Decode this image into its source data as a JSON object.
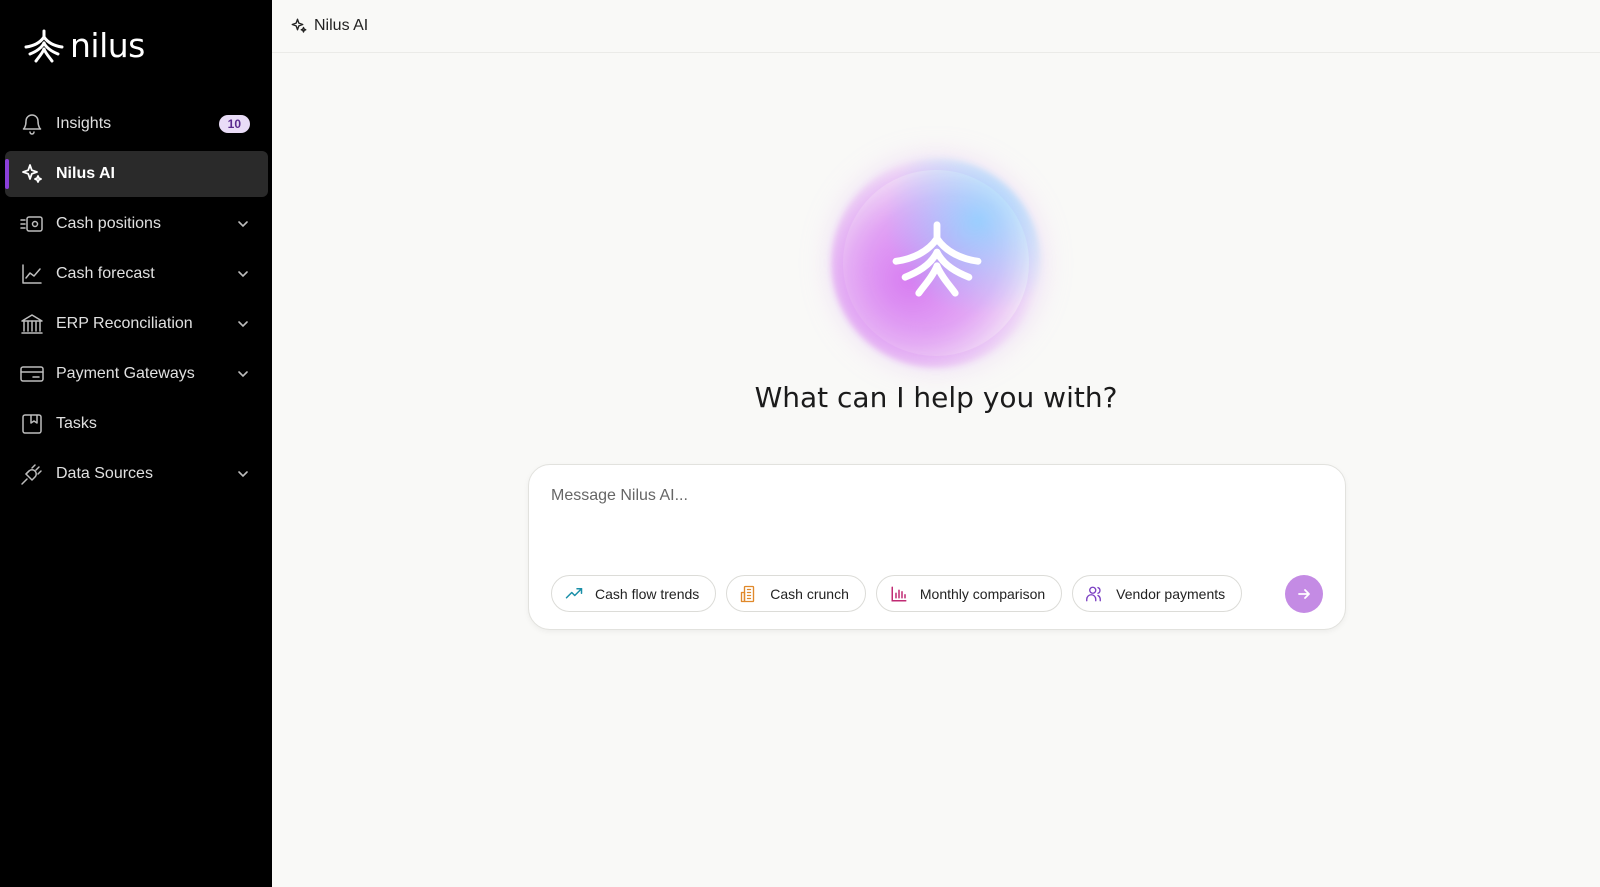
{
  "app": {
    "brand": "nilus"
  },
  "sidebar": {
    "items": [
      {
        "label": "Insights",
        "icon": "bell-icon",
        "badge": "10",
        "active": false,
        "expandable": false
      },
      {
        "label": "Nilus AI",
        "icon": "sparkles-icon",
        "active": true,
        "expandable": false
      },
      {
        "label": "Cash positions",
        "icon": "cash-positions-icon",
        "active": false,
        "expandable": true
      },
      {
        "label": "Cash forecast",
        "icon": "line-chart-icon",
        "active": false,
        "expandable": true
      },
      {
        "label": "ERP Reconciliation",
        "icon": "bank-icon",
        "active": false,
        "expandable": true
      },
      {
        "label": "Payment Gateways",
        "icon": "credit-card-icon",
        "active": false,
        "expandable": true
      },
      {
        "label": "Tasks",
        "icon": "book-icon",
        "active": false,
        "expandable": false
      },
      {
        "label": "Data Sources",
        "icon": "plug-icon",
        "active": false,
        "expandable": true
      }
    ],
    "active_color": "#8b3fd9"
  },
  "header": {
    "title": "Nilus AI",
    "icon": "sparkles-icon"
  },
  "main": {
    "headline": "What can I help you with?",
    "composer": {
      "placeholder": "Message Nilus AI...",
      "value": "",
      "send_icon": "arrow-right-icon",
      "send_color": "#c48be4"
    },
    "suggestions": [
      {
        "label": "Cash flow trends",
        "icon": "trending-up-icon",
        "color": "#1a8fa8"
      },
      {
        "label": "Cash crunch",
        "icon": "building-icon",
        "color": "#e0892b"
      },
      {
        "label": "Monthly comparison",
        "icon": "bar-chart-icon",
        "color": "#c02a73"
      },
      {
        "label": "Vendor payments",
        "icon": "users-icon",
        "color": "#7b3fc2"
      }
    ]
  }
}
